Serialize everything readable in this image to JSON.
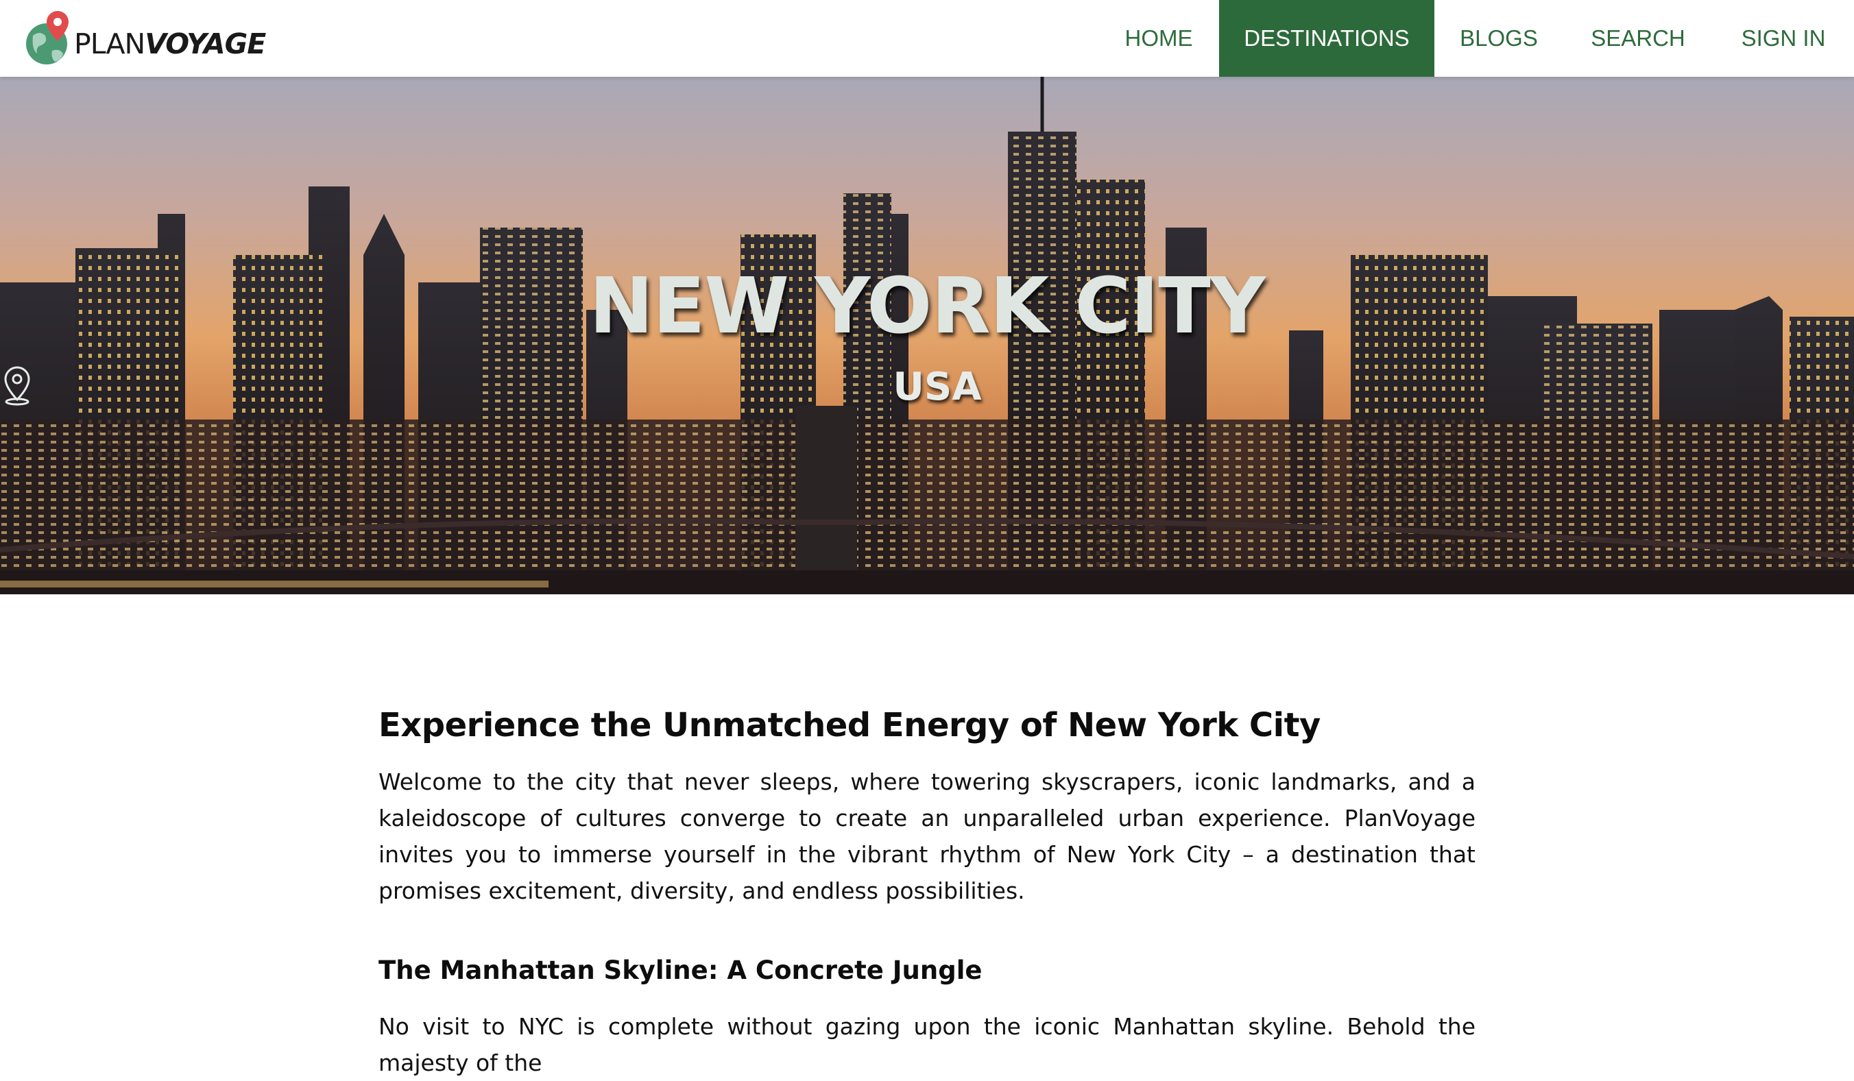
{
  "brand": {
    "part1": "PLAN",
    "part2": "VOYAGE"
  },
  "nav": {
    "home": "HOME",
    "destinations": "DESTINATIONS",
    "blogs": "BLOGS",
    "search": "SEARCH",
    "sign_in": "SIGN IN"
  },
  "hero": {
    "title": "NEW YORK CITY",
    "country": "USA"
  },
  "article": {
    "heading": "Experience the Unmatched Energy of New York City",
    "intro": "Welcome to the city that never sleeps, where towering skyscrapers, iconic landmarks, and a kaleidoscope of cultures converge to create an unparalleled urban experience. PlanVoyage invites you to immerse yourself in the vibrant rhythm of New York City – a destination that promises excitement, diversity, and endless possibilities.",
    "section1_heading": "The Manhattan Skyline: A Concrete Jungle",
    "section1_text": "No visit to NYC is complete without gazing upon the iconic Manhattan skyline. Behold the majesty of the"
  },
  "colors": {
    "accent": "#2d6a3b",
    "nav_text": "#2e6b3c"
  }
}
